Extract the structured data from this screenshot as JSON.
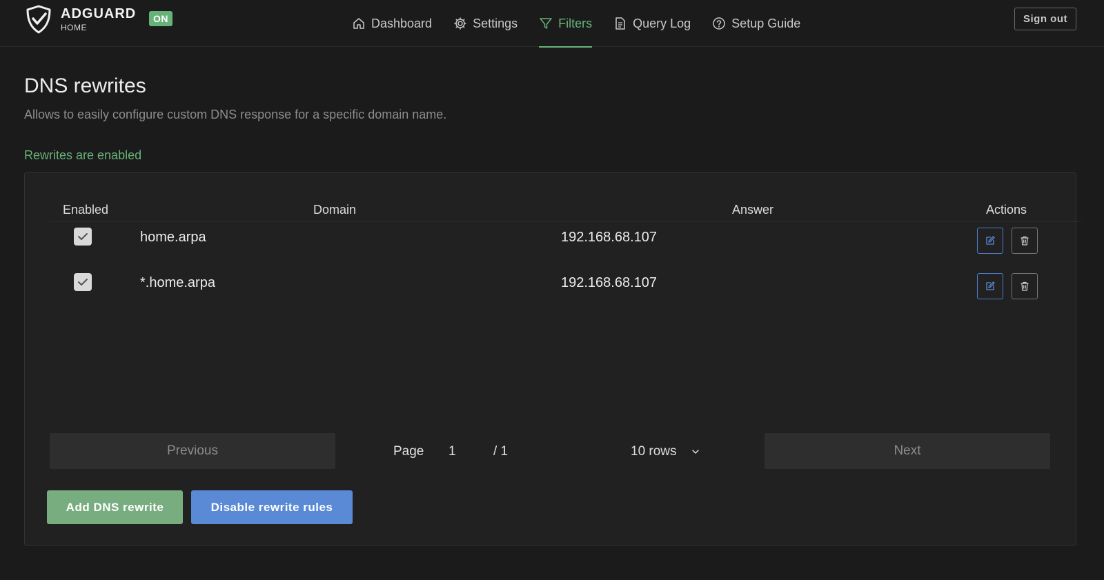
{
  "app": {
    "brand_title": "ADGUARD",
    "brand_subtitle": "HOME",
    "status_badge": "ON",
    "accent_color": "#67b279"
  },
  "nav": {
    "items": [
      {
        "label": "Dashboard",
        "icon": "home-icon",
        "active": false
      },
      {
        "label": "Settings",
        "icon": "gear-icon",
        "active": false
      },
      {
        "label": "Filters",
        "icon": "filter-icon",
        "active": true
      },
      {
        "label": "Query Log",
        "icon": "document-icon",
        "active": false
      },
      {
        "label": "Setup Guide",
        "icon": "question-circle-icon",
        "active": false
      }
    ],
    "signout_label": "Sign out"
  },
  "page": {
    "title": "DNS rewrites",
    "description": "Allows to easily configure custom DNS response for a specific domain name.",
    "status_text": "Rewrites are enabled"
  },
  "table": {
    "columns": [
      "Enabled",
      "Domain",
      "Answer",
      "Actions"
    ],
    "rows": [
      {
        "enabled": true,
        "domain": "home.arpa",
        "answer": "192.168.68.107"
      },
      {
        "enabled": true,
        "domain": "*.home.arpa",
        "answer": "192.168.68.107"
      }
    ]
  },
  "pagination": {
    "previous_label": "Previous",
    "page_label": "Page",
    "current_page": "1",
    "total_pages": "/ 1",
    "rows_selected": "10 rows",
    "next_label": "Next"
  },
  "actions": {
    "add_label": "Add DNS rewrite",
    "disable_label": "Disable rewrite rules"
  }
}
